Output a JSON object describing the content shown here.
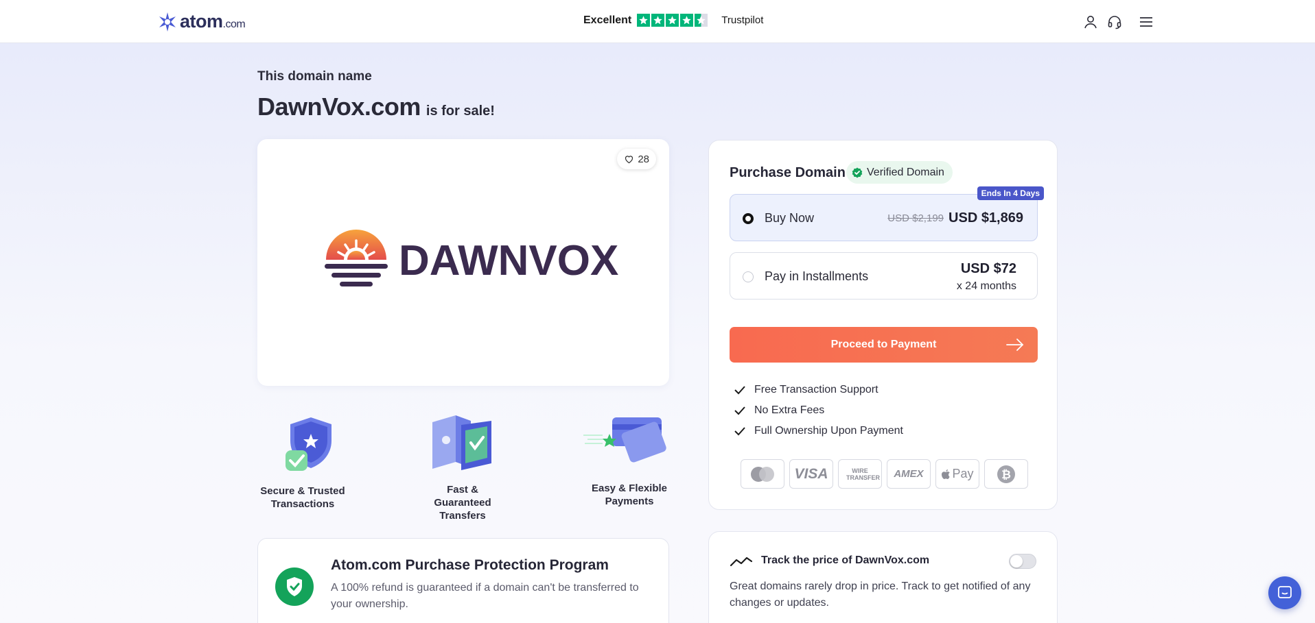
{
  "header": {
    "logo_text": "atom",
    "logo_suffix": ".com",
    "trustpilot_rating_text": "Excellent",
    "trustpilot_stars": 4.5,
    "trustpilot_name": "Trustpilot",
    "icons": [
      "user-icon",
      "headset-icon",
      "menu-icon"
    ]
  },
  "hero": {
    "kicker": "This domain name",
    "domain": "DawnVox.com",
    "suffix": "is for sale!"
  },
  "logo_card": {
    "brand_text": "DAWNVOX",
    "like_count": "28"
  },
  "features": [
    {
      "line1": "Secure & Trusted",
      "line2": "Transactions"
    },
    {
      "line1": "Fast & Guaranteed",
      "line2": "Transfers"
    },
    {
      "line1": "Easy & Flexible",
      "line2": "Payments"
    }
  ],
  "protection": {
    "title": "Atom.com Purchase Protection Program",
    "text": "A 100% refund is guaranteed if a domain can't be transferred to your ownership."
  },
  "purchase": {
    "title": "Purchase Domain",
    "verified_label": "Verified Domain",
    "buy_now": {
      "label": "Buy Now",
      "old_price": "USD $2,199",
      "price": "USD $1,869",
      "badge": "Ends In 4 Days",
      "selected": true
    },
    "installments": {
      "label": "Pay in Installments",
      "price": "USD $72",
      "term": "x 24 months",
      "selected": false
    },
    "cta_label": "Proceed to Payment",
    "benefits": [
      "Free Transaction Support",
      "No Extra Fees",
      "Full Ownership Upon Payment"
    ],
    "payment_methods": [
      "mastercard",
      "VISA",
      "WIRE TRANSFER",
      "AMEX",
      "Pay",
      "bitcoin"
    ]
  },
  "track": {
    "title": "Track the price of DawnVox.com",
    "text": "Great domains rarely drop in price. Track to get notified of any changes or updates.",
    "enabled": false
  },
  "colors": {
    "accent_blue": "#4361d8",
    "cta_orange": "#f86a50",
    "trustpilot_green": "#00b67a",
    "verified_green": "#14a35a",
    "badge_indigo": "#4a56c9"
  }
}
